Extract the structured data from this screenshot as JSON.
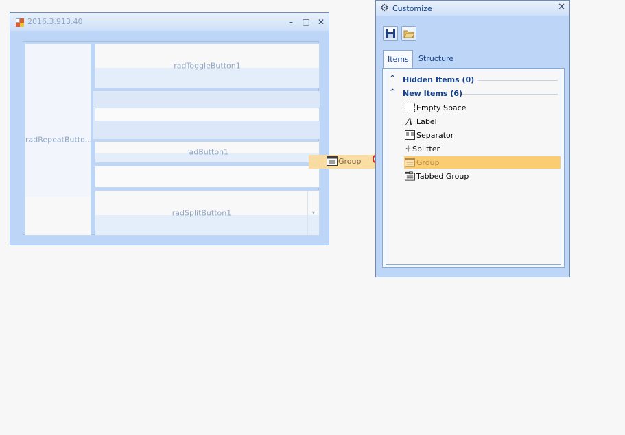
{
  "main_form": {
    "title": "2016.3.913.40",
    "minimize_glyph": "–",
    "maximize_glyph": "□",
    "close_glyph": "✕",
    "controls": {
      "repeat_button": "radRepeatButto...",
      "toggle_button": "radToggleButton1",
      "button": "radButton1",
      "split_button": "radSplitButton1",
      "split_arrow": "▾"
    }
  },
  "drag_ghost": {
    "label": "Group",
    "icon": "group-icon"
  },
  "customize": {
    "title": "Customize",
    "close_glyph": "✕",
    "toolbar": {
      "save_icon": "save-icon",
      "open_icon": "open-folder-icon"
    },
    "tabs": [
      {
        "label": "Items",
        "active": true
      },
      {
        "label": "Structure",
        "active": false
      }
    ],
    "groups": {
      "hidden": {
        "label": "Hidden Items (0)",
        "chevron": "^"
      },
      "new": {
        "label": "New Items (6)",
        "chevron": "^"
      }
    },
    "items": [
      {
        "label": "Empty Space",
        "icon": "empty-space-icon"
      },
      {
        "label": "Label",
        "icon": "label-icon"
      },
      {
        "label": "Separator",
        "icon": "separator-icon"
      },
      {
        "label": "Splitter",
        "icon": "splitter-icon"
      },
      {
        "label": "Group",
        "icon": "group-icon",
        "selected": true
      },
      {
        "label": "Tabbed Group",
        "icon": "tabbed-group-icon"
      }
    ]
  },
  "colors": {
    "form_bg": "#bdd6f7",
    "selection": "#fbcd72",
    "text_blue": "#15428b",
    "disabled_text": "#8ea6c7"
  }
}
